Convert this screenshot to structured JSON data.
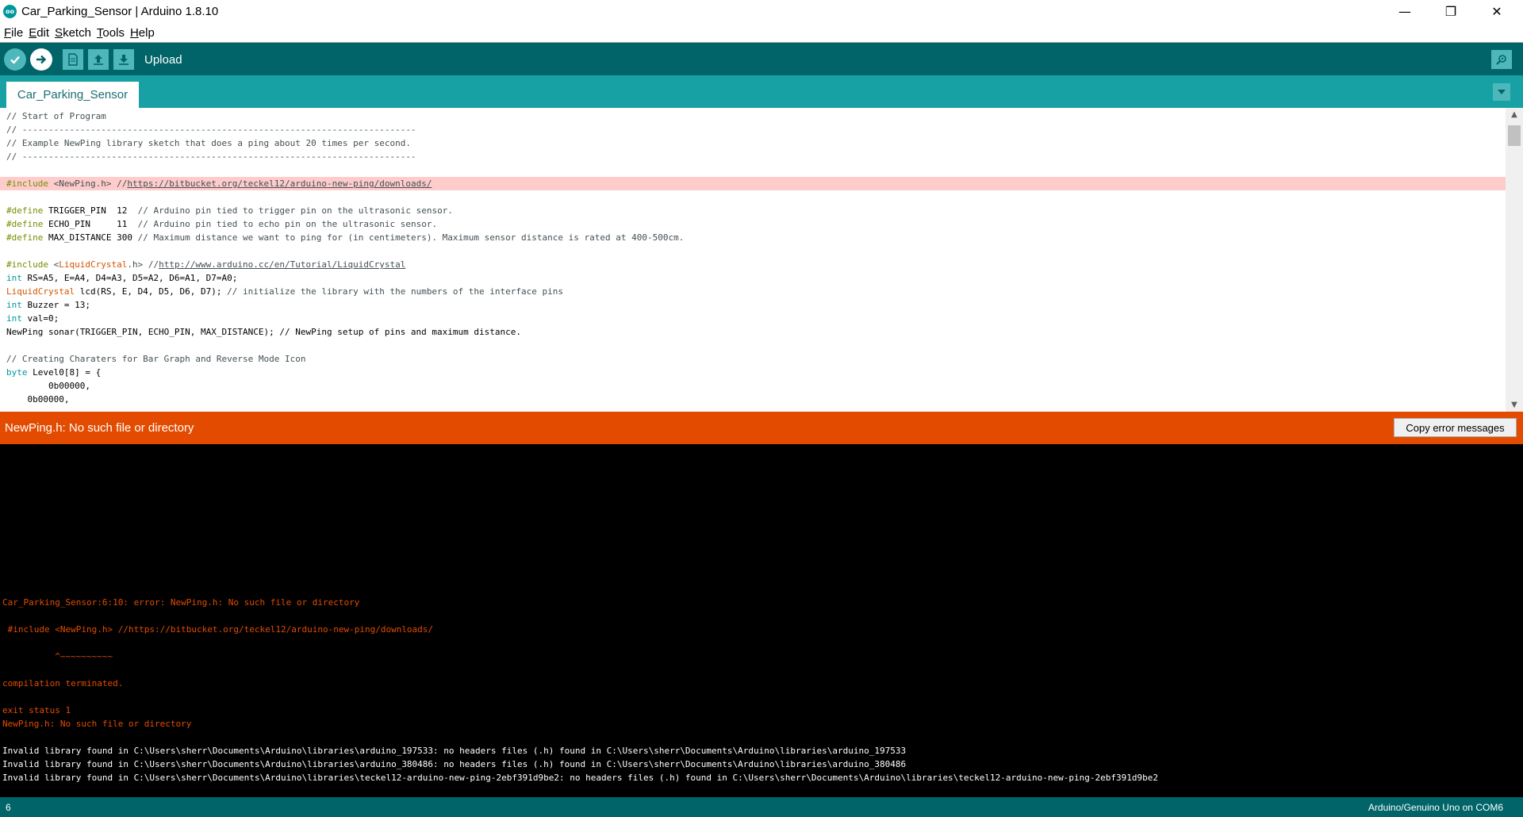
{
  "window": {
    "icon_text": "oo",
    "title": "Car_Parking_Sensor | Arduino 1.8.10",
    "minimize": "—",
    "maximize": "❐",
    "close": "✕"
  },
  "menu": [
    {
      "label": "File",
      "mnemonic": "F",
      "rest": "ile"
    },
    {
      "label": "Edit",
      "mnemonic": "E",
      "rest": "dit"
    },
    {
      "label": "Sketch",
      "mnemonic": "S",
      "rest": "ketch"
    },
    {
      "label": "Tools",
      "mnemonic": "T",
      "rest": "ools"
    },
    {
      "label": "Help",
      "mnemonic": "H",
      "rest": "elp"
    }
  ],
  "toolbar": {
    "hover_label": "Upload",
    "icons": [
      "verify-icon",
      "upload-icon",
      "new-icon",
      "open-icon",
      "save-icon",
      "serial-monitor-icon"
    ]
  },
  "tabs": [
    {
      "label": "Car_Parking_Sensor"
    }
  ],
  "editor": {
    "lines": [
      "// Start of Program",
      "// ---------------------------------------------------------------------------",
      "// Example NewPing library sketch that does a ping about 20 times per second.",
      "// ---------------------------------------------------------------------------",
      "",
      "#include <NewPing.h> //https://bitbucket.org/teckel12/arduino-new-ping/downloads/",
      "",
      "#define TRIGGER_PIN  12  // Arduino pin tied to trigger pin on the ultrasonic sensor.",
      "#define ECHO_PIN     11  // Arduino pin tied to echo pin on the ultrasonic sensor.",
      "#define MAX_DISTANCE 300 // Maximum distance we want to ping for (in centimeters). Maximum sensor distance is rated at 400-500cm.",
      "",
      "#include <LiquidCrystal.h> //http://www.arduino.cc/en/Tutorial/LiquidCrystal",
      "int RS=A5, E=A4, D4=A3, D5=A2, D6=A1, D7=A0;",
      "LiquidCrystal lcd(RS, E, D4, D5, D6, D7); // initialize the library with the numbers of the interface pins",
      "int Buzzer = 13;",
      "int val=0;",
      "NewPing sonar(TRIGGER_PIN, ECHO_PIN, MAX_DISTANCE); // NewPing setup of pins and maximum distance.",
      "",
      "// Creating Charaters for Bar Graph and Reverse Mode Icon",
      "byte Level0[8] = {",
      "        0b00000,",
      "    0b00000,"
    ]
  },
  "error_bar": {
    "message": "NewPing.h: No such file or directory",
    "copy_button": "Copy error messages"
  },
  "console": {
    "lines": [
      {
        "text": "Car_Parking_Sensor:6:10: error: NewPing.h: No such file or directory",
        "kind": "err"
      },
      {
        "text": "",
        "kind": "err"
      },
      {
        "text": " #include <NewPing.h> //https://bitbucket.org/teckel12/arduino-new-ping/downloads/",
        "kind": "err"
      },
      {
        "text": "",
        "kind": "err"
      },
      {
        "text": "          ^~~~~~~~~~~",
        "kind": "err"
      },
      {
        "text": "",
        "kind": "err"
      },
      {
        "text": "compilation terminated.",
        "kind": "err"
      },
      {
        "text": "",
        "kind": "err"
      },
      {
        "text": "exit status 1",
        "kind": "err"
      },
      {
        "text": "NewPing.h: No such file or directory",
        "kind": "err"
      },
      {
        "text": "",
        "kind": "info"
      },
      {
        "text": "Invalid library found in C:\\Users\\sherr\\Documents\\Arduino\\libraries\\arduino_197533: no headers files (.h) found in C:\\Users\\sherr\\Documents\\Arduino\\libraries\\arduino_197533",
        "kind": "info"
      },
      {
        "text": "Invalid library found in C:\\Users\\sherr\\Documents\\Arduino\\libraries\\arduino_380486: no headers files (.h) found in C:\\Users\\sherr\\Documents\\Arduino\\libraries\\arduino_380486",
        "kind": "info"
      },
      {
        "text": "Invalid library found in C:\\Users\\sherr\\Documents\\Arduino\\libraries\\teckel12-arduino-new-ping-2ebf391d9be2: no headers files (.h) found in C:\\Users\\sherr\\Documents\\Arduino\\libraries\\teckel12-arduino-new-ping-2ebf391d9be2",
        "kind": "info"
      }
    ]
  },
  "status": {
    "line_number": "6",
    "board": "Arduino/Genuino Uno on COM6"
  },
  "colors": {
    "toolbar": "#006468",
    "tabbar": "#17a1a5",
    "error_bar": "#e34c00",
    "highlight_line": "#ffcccc",
    "console_bg": "#000000"
  }
}
